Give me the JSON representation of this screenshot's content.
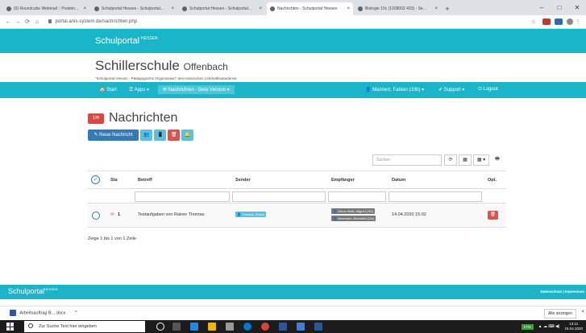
{
  "browser": {
    "tabs": [
      {
        "label": "(0) Roundcube Webmail :: Postein..."
      },
      {
        "label": "Schulportal Hessen - Schulportal..."
      },
      {
        "label": "Schulportal Hessen - Schulportal..."
      },
      {
        "label": "Nachrichten - Schulportal Hessen"
      },
      {
        "label": "Biologie 10c (1028002 433) - Se..."
      }
    ],
    "new_tab": "+",
    "url": "portal.anis-system.de/nachrichten.php"
  },
  "site": {
    "brand": "Schulportal",
    "brand_sup": "HESSEN",
    "school_name": "Schillerschule",
    "school_city": "Offenbach",
    "school_desc": "\"Schulportal Hessen - Pädagogische Organisation\" des Hessischen Lehrkräfteakademie"
  },
  "nav": {
    "start": "🏠 Start",
    "apps": "☰ Apps ▾",
    "messages": "✉ Nachrichten - Beta Version ▾",
    "user": "👤 Mannert, Fabian (10b) ▾",
    "support": "✔ Support ▾",
    "logout": "⏻ Logout"
  },
  "page": {
    "badge": "1✉",
    "title": "Nachrichten",
    "new_message": "✎ Neue Nachricht",
    "btn_group": "👥",
    "btn_mobile": "📱",
    "btn_trash": "🗑",
    "btn_bell": "🔔",
    "search_placeholder": "Suchen",
    "tool_refresh": "⟳",
    "tool_columns": "▦",
    "tool_grid": "▦ ▾",
    "tool_print": "🖶"
  },
  "table": {
    "headers": [
      "Sta",
      "Betreff",
      "Sender",
      "Empfänger",
      "Datum",
      "Opt."
    ],
    "rows": [
      {
        "status_count": "1",
        "subject": "Testaufgaben von Rainer Thomas",
        "sender": "👤 Thomas, Rainer",
        "recipients": [
          "👤 Demo Walz, Miguel (10f)",
          "👤 Neumann, Benedikt (10c)"
        ],
        "date": "14.04.2020 15:02"
      }
    ],
    "pager": "Zeige 1 bis 1 von 1 Zeile"
  },
  "footer": {
    "brand": "Schulportal",
    "brand_sup": "HESSEN",
    "links": "Datenschutz | Impressum"
  },
  "download": {
    "file": "Arbeitsauftrag B....docx",
    "chevron": "^",
    "show_all": "Alle anzeigen",
    "close": "×"
  },
  "taskbar": {
    "search_placeholder": "Zur Suche Text hier eingeben",
    "battery": "17%",
    "time": "13:11",
    "date": "15.04.2020"
  },
  "colors": {
    "primary": "#1ab5c8",
    "button_blue": "#337ab7",
    "button_cyan": "#5bc0de",
    "danger": "#d9534f"
  }
}
